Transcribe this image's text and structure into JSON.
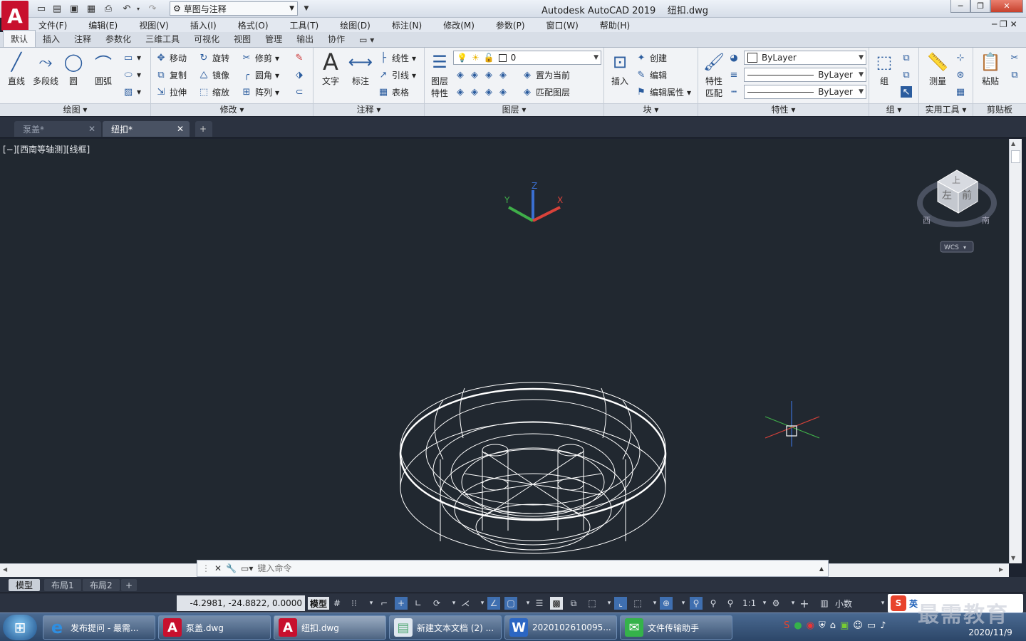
{
  "app": {
    "logo": "A",
    "title": "Autodesk AutoCAD 2019    纽扣.dwg",
    "workspace": "草图与注释"
  },
  "menubar": [
    "文件(F)",
    "编辑(E)",
    "视图(V)",
    "插入(I)",
    "格式(O)",
    "工具(T)",
    "绘图(D)",
    "标注(N)",
    "修改(M)",
    "参数(P)",
    "窗口(W)",
    "帮助(H)"
  ],
  "ribbon_tabs": [
    "默认",
    "插入",
    "注释",
    "参数化",
    "三维工具",
    "可视化",
    "视图",
    "管理",
    "输出",
    "协作"
  ],
  "ribbon": {
    "draw": {
      "line": "直线",
      "polyline": "多段线",
      "circle": "圆",
      "arc": "圆弧",
      "label": "绘图"
    },
    "modify": {
      "move": "移动",
      "rotate": "旋转",
      "trim": "修剪",
      "copy": "复制",
      "mirror": "镜像",
      "fillet": "圆角",
      "stretch": "拉伸",
      "scale": "缩放",
      "array": "阵列",
      "label": "修改"
    },
    "annotation": {
      "text": "文字",
      "dimension": "标注",
      "linear": "线性",
      "leader": "引线",
      "table": "表格",
      "label": "注释"
    },
    "layers": {
      "props_l1": "图层",
      "props_l2": "特性",
      "layer_value": "0",
      "set_current": "置为当前",
      "match_layer": "匹配图层",
      "label": "图层"
    },
    "block": {
      "insert": "插入",
      "create": "创建",
      "edit": "编辑",
      "edit_attr": "编辑属性",
      "label": "块"
    },
    "properties": {
      "match_l1": "特性",
      "match_l2": "匹配",
      "color": "ByLayer",
      "linetype": "ByLayer",
      "lineweight": "ByLayer",
      "label": "特性"
    },
    "groups": {
      "group": "组",
      "label": "组"
    },
    "utilities": {
      "measure": "测量",
      "label": "实用工具"
    },
    "clipboard": {
      "paste": "粘贴",
      "label": "剪贴板"
    }
  },
  "file_tabs": [
    "泵盖*",
    "纽扣*"
  ],
  "viewport": {
    "label": "[−][西南等轴测][线框]",
    "viewcube_top": "上",
    "viewcube_left": "左",
    "viewcube_front": "前",
    "compass": "西",
    "compass_south": "南",
    "wcs": "WCS",
    "axis_x": "X",
    "axis_y": "Y",
    "axis_z": "Z"
  },
  "command": {
    "placeholder": "键入命令"
  },
  "layout_tabs": [
    "模型",
    "布局1",
    "布局2"
  ],
  "status": {
    "coords": "-4.2981, -24.8822, 0.0000",
    "model": "模型",
    "scale": "1:1",
    "units": "小数"
  },
  "taskbar": {
    "items": [
      "发布提问 - 最需...",
      "泵盖.dwg",
      "纽扣.dwg",
      "新建文本文档 (2) ...",
      "2020102610095...",
      "文件传输助手"
    ],
    "ime": "英",
    "date": "2020/11/9"
  },
  "watermark": "最需教育",
  "colors": {
    "viewport_bg": "#212830",
    "autocad_red": "#c8102e",
    "ribbon_bg": "#f1f3f6",
    "axis_x": "#d9423a",
    "axis_y": "#3fae49",
    "axis_z": "#3a6fd1"
  }
}
